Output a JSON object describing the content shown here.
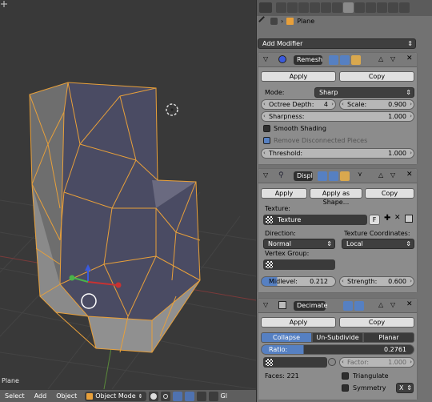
{
  "viewport": {
    "object_label": "Plane"
  },
  "bottom_bar": {
    "select": "Select",
    "add": "Add",
    "object": "Object",
    "mode": "Object Mode",
    "gl": "Gl"
  },
  "panel": {
    "breadcrumb": "Plane",
    "add_modifier": "Add Modifier",
    "remesh": {
      "name": "Remesh",
      "apply": "Apply",
      "copy": "Copy",
      "mode_label": "Mode:",
      "mode_value": "Sharp",
      "octree_label": "Octree Depth:",
      "octree_value": "4",
      "scale_label": "Scale:",
      "scale_value": "0.900",
      "sharpness_label": "Sharpness:",
      "sharpness_value": "1.000",
      "smooth_shading": "Smooth Shading",
      "remove_disconnected": "Remove Disconnected Pieces",
      "threshold_label": "Threshold:",
      "threshold_value": "1.000"
    },
    "displace": {
      "name": "Displ",
      "apply": "Apply",
      "apply_shape": "Apply as Shape...",
      "copy": "Copy",
      "texture_label": "Texture:",
      "texture_value": "Texture",
      "texture_f": "F",
      "direction_label": "Direction:",
      "direction_value": "Normal",
      "tex_coords_label": "Texture Coordinates:",
      "tex_coords_value": "Local",
      "vertex_group_label": "Vertex Group:",
      "midlevel_label": "Midlevel:",
      "midlevel_value": "0.212",
      "strength_label": "Strength:",
      "strength_value": "0.600"
    },
    "decimate": {
      "name": "Decimate",
      "apply": "Apply",
      "copy": "Copy",
      "tabs": [
        "Collapse",
        "Un-Subdivide",
        "Planar"
      ],
      "active_tab": "Collapse",
      "ratio_label": "Ratio:",
      "ratio_value": "0.2761",
      "factor_label": "Factor:",
      "factor_value": "1.000",
      "faces": "Faces: 221",
      "triangulate": "Triangulate",
      "symmetry": "Symmetry",
      "axis": "X"
    }
  },
  "colors": {
    "accent": "#5680c2",
    "wire": "#e8a03a",
    "viewport_bg": "#393939",
    "panel_bg": "#727272"
  }
}
